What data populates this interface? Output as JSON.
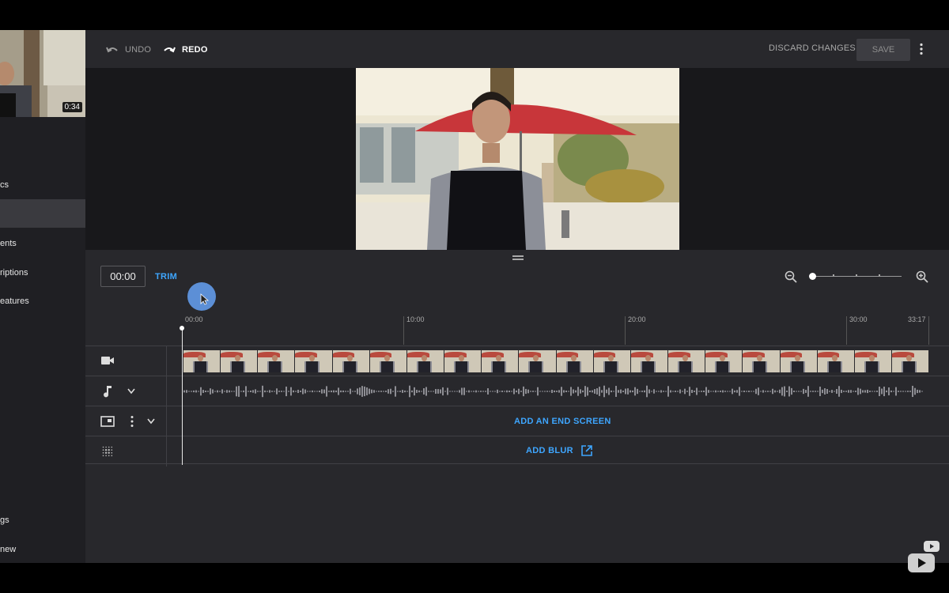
{
  "sidebar": {
    "thumbnail_duration": "0:34",
    "items": [
      {
        "label": "cs",
        "active": false
      },
      {
        "label": "",
        "active": true
      },
      {
        "label": "ents",
        "active": false
      },
      {
        "label": "riptions",
        "active": false
      },
      {
        "label": "eatures",
        "active": false
      },
      {
        "label": "gs",
        "active": false
      },
      {
        "label": "new",
        "active": false
      }
    ]
  },
  "header": {
    "undo_label": "UNDO",
    "redo_label": "REDO",
    "discard_label": "DISCARD CHANGES",
    "save_label": "SAVE"
  },
  "timeline": {
    "current_time": "00:00",
    "trim_label": "TRIM",
    "ruler": [
      "00:00",
      "10:00",
      "20:00",
      "30:00",
      "33:17"
    ],
    "end_screen_label": "ADD AN END SCREEN",
    "blur_label": "ADD BLUR"
  },
  "colors": {
    "accent": "#3ea6ff",
    "background": "#28282c",
    "sidebar": "#1f1f23"
  }
}
